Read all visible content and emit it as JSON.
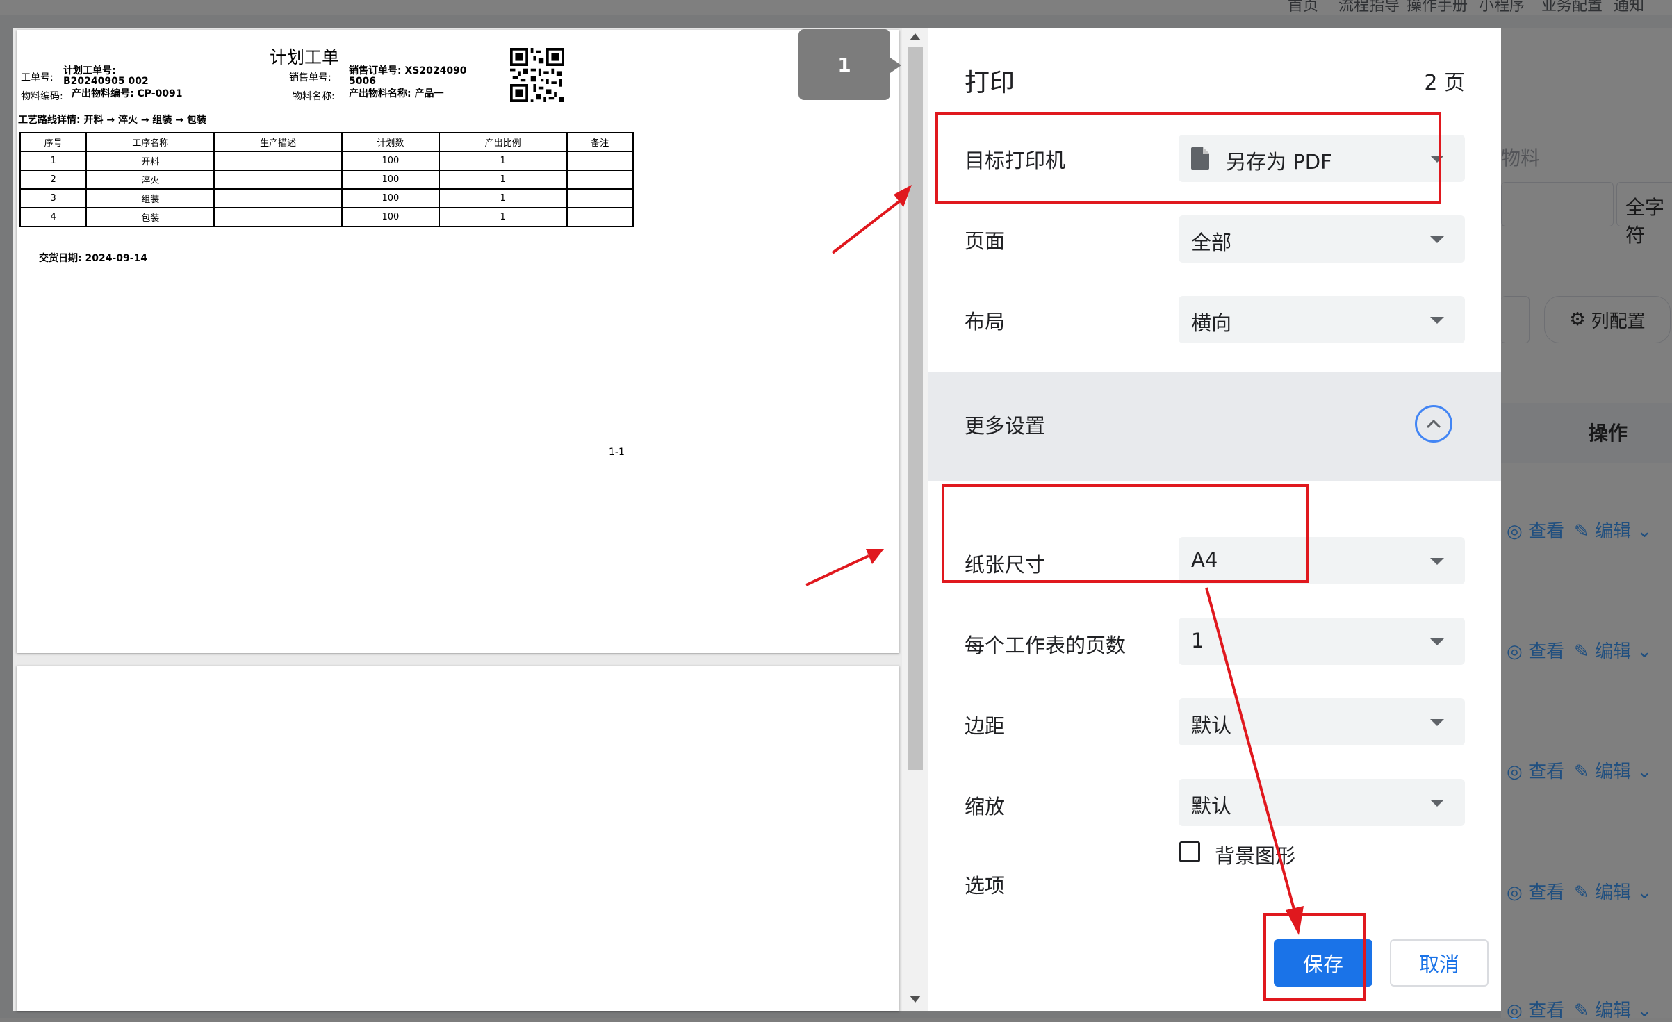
{
  "background": {
    "top_nav": [
      "首页",
      "流程指导",
      "操作手册",
      "小程序",
      "业务配置",
      "通知"
    ],
    "field_material": "物料",
    "search_dropdown": "全字符",
    "column_config_button": "列配置",
    "actions_header": "操作",
    "row_actions": {
      "view": "查看",
      "edit": "编辑"
    }
  },
  "preview": {
    "page_indicator": "1",
    "document": {
      "title": "计划工单",
      "work_order_label": "工单号:",
      "work_order_value": "计划工单号: B20240905 002",
      "sales_order_label": "销售单号:",
      "sales_order_value": "销售订单号: XS2024090 5006",
      "material_code_label": "物料编码:",
      "material_code_value": "产出物料编号: CP-0091",
      "material_name_label": "物料名称:",
      "material_name_value": "产出物料名称: 产品一",
      "route_text": "工艺路线详情: 开料 → 淬火 → 组装 → 包装",
      "table_headers": [
        "序号",
        "工序名称",
        "生产描述",
        "计划数",
        "产出比例",
        "备注"
      ],
      "table_rows": [
        [
          "1",
          "开料",
          "",
          "100",
          "1",
          ""
        ],
        [
          "2",
          "淬火",
          "",
          "100",
          "1",
          ""
        ],
        [
          "3",
          "组装",
          "",
          "100",
          "1",
          ""
        ],
        [
          "4",
          "包装",
          "",
          "100",
          "1",
          ""
        ]
      ],
      "delivery_date": "交货日期: 2024-09-14",
      "page_footer": "1-1"
    }
  },
  "print_panel": {
    "title": "打印",
    "page_count": "2 页",
    "destination_label": "目标打印机",
    "destination_value": "另存为 PDF",
    "destination_icon": "file-icon",
    "pages_label": "页面",
    "pages_value": "全部",
    "layout_label": "布局",
    "layout_value": "横向",
    "more_settings_label": "更多设置",
    "paper_size_label": "纸张尺寸",
    "paper_size_value": "A4",
    "pages_per_sheet_label": "每个工作表的页数",
    "pages_per_sheet_value": "1",
    "margins_label": "边距",
    "margins_value": "默认",
    "scale_label": "缩放",
    "scale_value": "默认",
    "options_label": "选项",
    "background_graphics_label": "背景图形",
    "background_graphics_checked": false,
    "save_button": "保存",
    "cancel_button": "取消"
  },
  "annotation_color": "#e0181e",
  "accent_color": "#1a73e8"
}
